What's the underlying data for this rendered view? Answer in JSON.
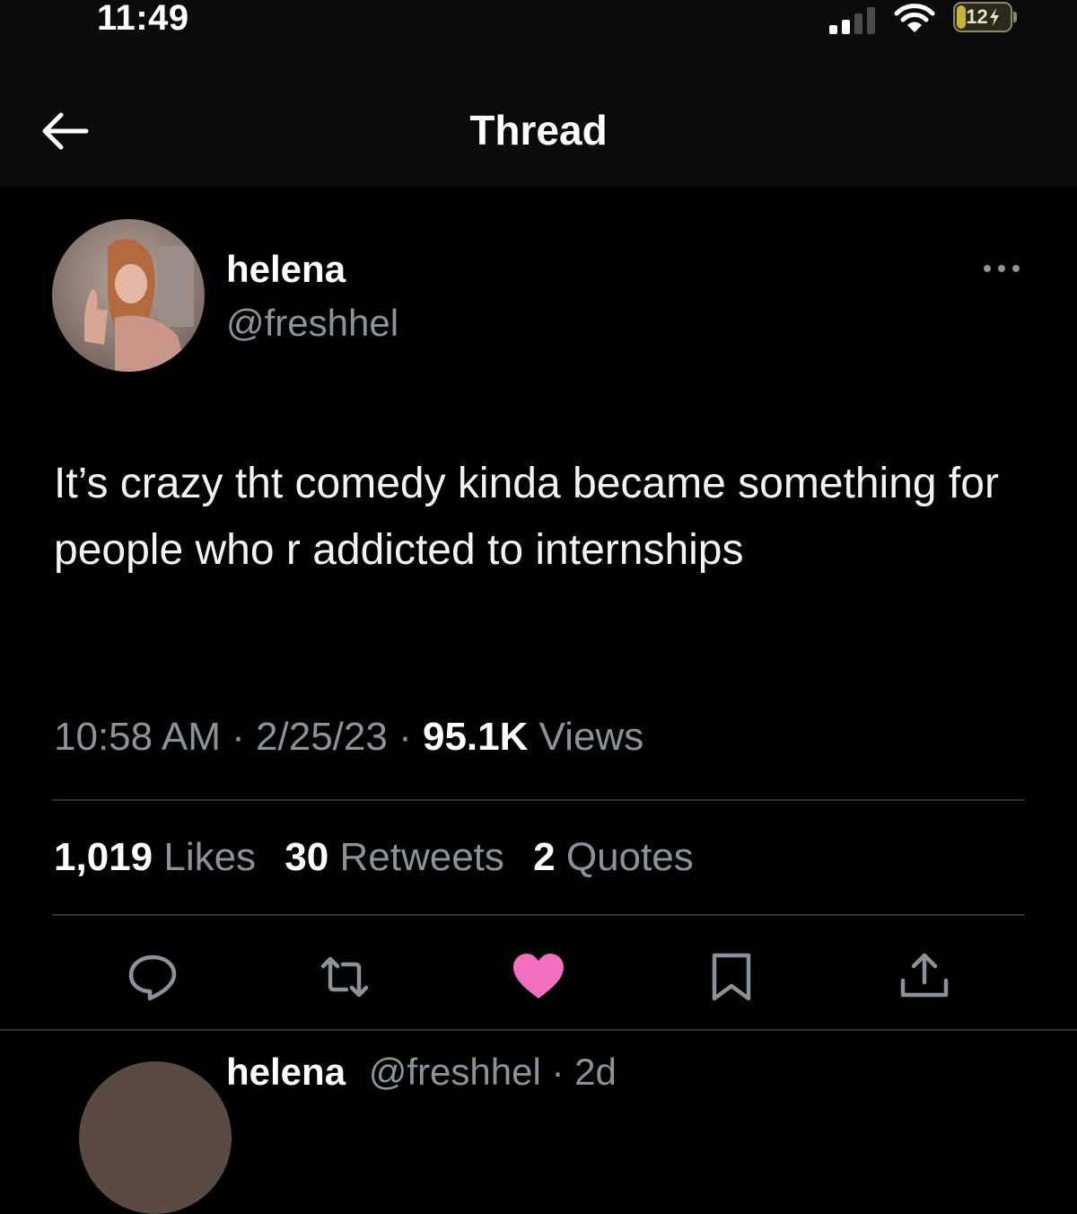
{
  "status_bar": {
    "time": "11:49",
    "battery": "12"
  },
  "header": {
    "title": "Thread"
  },
  "tweet": {
    "author_name": "helena",
    "author_handle": "@freshhel",
    "text": "It’s crazy tht comedy kinda became something for people who r addicted to internships",
    "time": "10:58 AM",
    "date": "2/25/23",
    "views_count": "95.1K",
    "views_label": "Views",
    "likes_count": "1,019",
    "likes_label": "Likes",
    "retweets_count": "30",
    "retweets_label": "Retweets",
    "quotes_count": "2",
    "quotes_label": "Quotes",
    "liked": true
  },
  "next_reply": {
    "author_name": "helena",
    "author_handle": "@freshhel",
    "age": "2d"
  },
  "icons": {
    "back": "back-arrow-icon",
    "more": "more-horizontal-icon",
    "reply": "reply-icon",
    "retweet": "retweet-icon",
    "like": "heart-filled-icon",
    "bookmark": "bookmark-icon",
    "share": "share-icon"
  },
  "colors": {
    "background": "#000000",
    "secondary_text": "#8b9299",
    "like_active": "#f26fbf",
    "divider": "#2a2d31"
  }
}
